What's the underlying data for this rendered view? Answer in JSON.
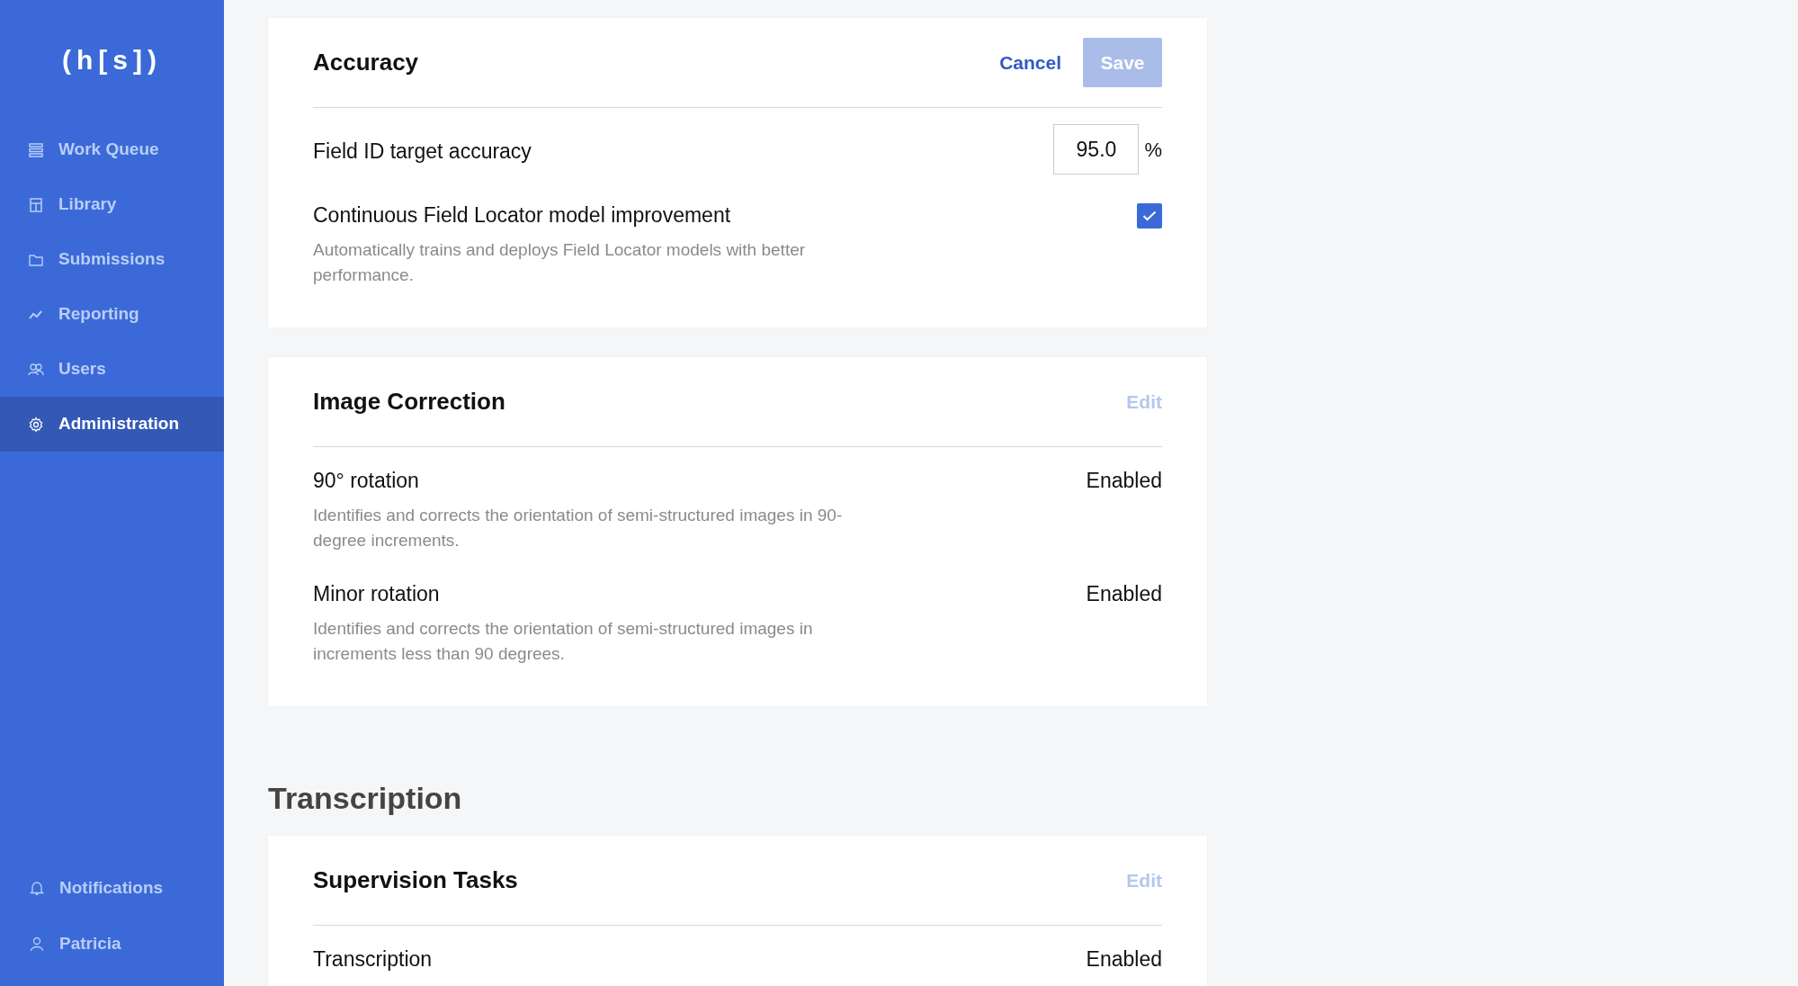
{
  "sidebar": {
    "logo": "(h[s])",
    "items": [
      {
        "label": "Work Queue",
        "selected": false
      },
      {
        "label": "Library",
        "selected": false
      },
      {
        "label": "Submissions",
        "selected": false
      },
      {
        "label": "Reporting",
        "selected": false
      },
      {
        "label": "Users",
        "selected": false
      },
      {
        "label": "Administration",
        "selected": true
      }
    ],
    "bottom_items": [
      {
        "label": "Notifications"
      },
      {
        "label": "Patricia"
      }
    ]
  },
  "sections": [
    {
      "cards": [
        {
          "title": "Accuracy",
          "editing": true,
          "cancel": "Cancel",
          "save": "Save",
          "save_disabled": true,
          "settings": [
            {
              "kind": "number",
              "label": "Field ID target accuracy",
              "value": "95.0",
              "unit": "%"
            },
            {
              "kind": "checkbox",
              "label": "Continuous Field Locator model improvement",
              "description": "Automatically trains and deploys Field Locator models with better performance.",
              "checked": true
            }
          ]
        },
        {
          "title": "Image Correction",
          "editing": false,
          "edit": "Edit",
          "settings": [
            {
              "kind": "status",
              "label": "90° rotation",
              "description": "Identifies and corrects the orientation of semi-structured images in 90-degree increments.",
              "value": "Enabled"
            },
            {
              "kind": "status",
              "label": "Minor rotation",
              "description": "Identifies and corrects the orientation of semi-structured images in increments less than 90 degrees.",
              "value": "Enabled"
            }
          ]
        }
      ]
    },
    {
      "heading": "Transcription",
      "cards": [
        {
          "title": "Supervision Tasks",
          "editing": false,
          "edit": "Edit",
          "settings": [
            {
              "kind": "status",
              "label": "Transcription",
              "value": "Enabled"
            }
          ]
        }
      ]
    }
  ]
}
